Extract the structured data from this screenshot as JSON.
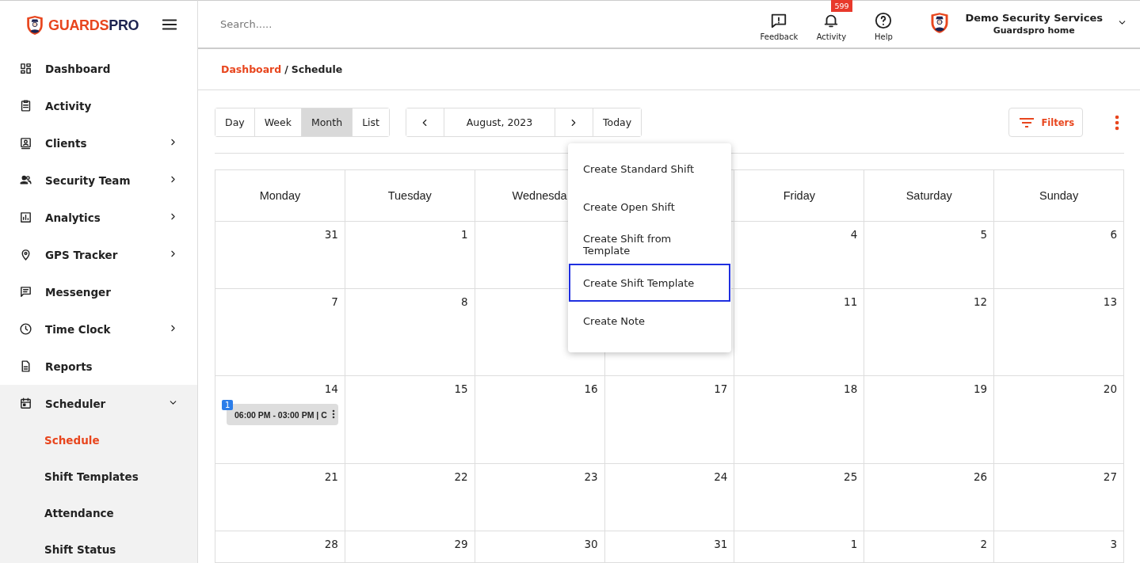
{
  "sidebar": {
    "logo": {
      "brand_part_1": "GUARDS",
      "brand_part_2": "PRO"
    },
    "items": [
      {
        "label": "Dashboard",
        "kind": "link"
      },
      {
        "label": "Activity",
        "kind": "link"
      },
      {
        "label": "Clients",
        "kind": "menu",
        "expanded": false
      },
      {
        "label": "Security Team",
        "kind": "menu",
        "expanded": false
      },
      {
        "label": "Analytics",
        "kind": "menu",
        "expanded": false
      },
      {
        "label": "GPS Tracker",
        "kind": "menu",
        "expanded": false
      },
      {
        "label": "Messenger",
        "kind": "link"
      },
      {
        "label": "Time Clock",
        "kind": "menu",
        "expanded": false
      },
      {
        "label": "Reports",
        "kind": "link"
      },
      {
        "label": "Scheduler",
        "kind": "menu",
        "expanded": true,
        "children": [
          {
            "label": "Schedule",
            "selected": true
          },
          {
            "label": "Shift Templates",
            "selected": false
          },
          {
            "label": "Attendance",
            "selected": false
          },
          {
            "label": "Shift Status",
            "selected": false
          }
        ]
      }
    ]
  },
  "header": {
    "search": {
      "placeholder": "Search....."
    },
    "actions": [
      {
        "label": "Feedback"
      },
      {
        "label": "Activity",
        "badge": "599"
      },
      {
        "label": "Help"
      }
    ],
    "account": {
      "name": "Demo Security Services",
      "subtitle": "Guardspro home"
    }
  },
  "breadcrumb": {
    "link": "Dashboard",
    "separator": "/",
    "current": "Schedule"
  },
  "view_tabs": [
    {
      "label": "Day",
      "selected": false
    },
    {
      "label": "Week",
      "selected": false
    },
    {
      "label": "Month",
      "selected": true
    },
    {
      "label": "List",
      "selected": false
    }
  ],
  "date_nav": {
    "period": "August, 2023",
    "today": "Today"
  },
  "filters_button": "Filters",
  "calendar": {
    "weekdays": [
      {
        "label": "Monday"
      },
      {
        "label": "Tuesday"
      },
      {
        "label": "Wednesda"
      },
      {
        "covered": true
      },
      {
        "label": "Friday"
      },
      {
        "label": "Saturday"
      },
      {
        "label": "Sunday"
      }
    ],
    "weeks": [
      {
        "days": [
          {
            "date": "31"
          },
          {
            "date": "1"
          },
          {
            "covered": true
          },
          {
            "covered": true
          },
          {
            "date": "4"
          },
          {
            "date": "5"
          },
          {
            "date": "6"
          }
        ]
      },
      {
        "days": [
          {
            "date": "7"
          },
          {
            "date": "8"
          },
          {
            "covered": true
          },
          {
            "covered": true
          },
          {
            "date": "11"
          },
          {
            "date": "12"
          },
          {
            "date": "13"
          }
        ]
      },
      {
        "days": [
          {
            "date": "14",
            "events": [
              {
                "count": "1",
                "text": "06:00 PM - 03:00 PM | C"
              }
            ]
          },
          {
            "date": "15"
          },
          {
            "date": "16"
          },
          {
            "date": "17"
          },
          {
            "date": "18"
          },
          {
            "date": "19"
          },
          {
            "date": "20"
          }
        ]
      },
      {
        "days": [
          {
            "date": "21"
          },
          {
            "date": "22"
          },
          {
            "date": "23"
          },
          {
            "date": "24"
          },
          {
            "date": "25"
          },
          {
            "date": "26"
          },
          {
            "date": "27"
          }
        ]
      },
      {
        "days": [
          {
            "date": "28"
          },
          {
            "date": "29"
          },
          {
            "date": "30"
          },
          {
            "date": "31"
          },
          {
            "date": "1"
          },
          {
            "date": "2"
          },
          {
            "date": "3"
          }
        ]
      }
    ]
  },
  "create_menu": {
    "items": [
      {
        "label": "Create Standard Shift",
        "focused": false
      },
      {
        "label": "Create Open Shift",
        "focused": false
      },
      {
        "label": "Create Shift from Template",
        "focused": false
      },
      {
        "label": "Create Shift Template",
        "focused": true
      },
      {
        "label": "Create Note",
        "focused": false
      }
    ]
  }
}
